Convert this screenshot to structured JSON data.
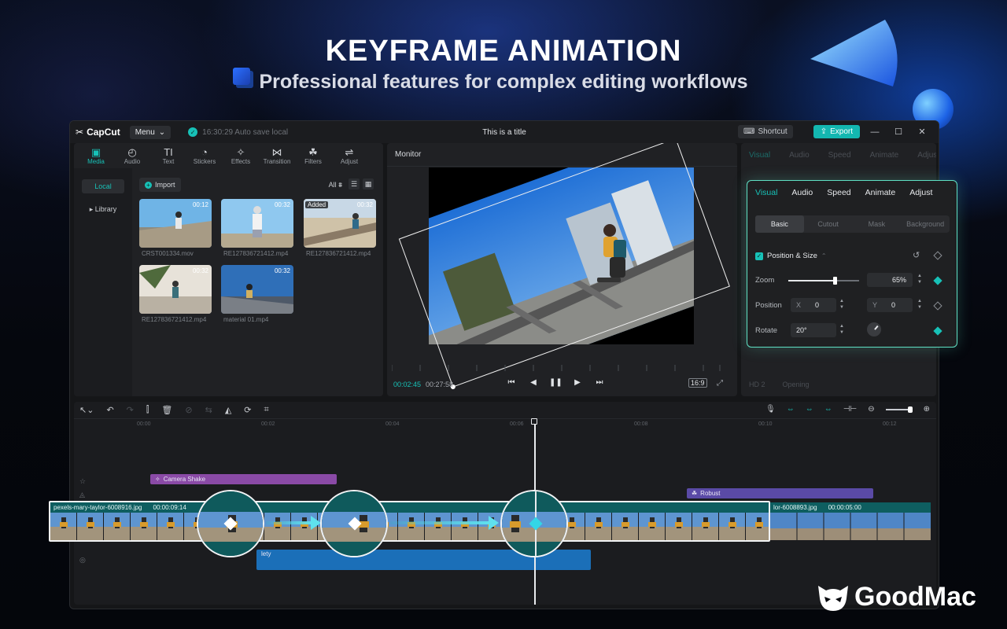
{
  "hero": {
    "title": "KEYFRAME ANIMATION",
    "subtitle": "Professional features for complex editing workflows"
  },
  "titlebar": {
    "app_name": "CapCut",
    "menu_label": "Menu",
    "autosave_text": "16:30:29 Auto save local",
    "document_title": "This is a title",
    "shortcut_label": "Shortcut",
    "export_label": "Export"
  },
  "media_tools": [
    {
      "label": "Media",
      "icon": "media-icon",
      "glyph": "▣",
      "active": true
    },
    {
      "label": "Audio",
      "icon": "audio-icon",
      "glyph": "◴",
      "active": false
    },
    {
      "label": "Text",
      "icon": "text-icon",
      "glyph": "TI",
      "active": false
    },
    {
      "label": "Stickers",
      "icon": "stickers-icon",
      "glyph": "◔",
      "active": false
    },
    {
      "label": "Effects",
      "icon": "effects-icon",
      "glyph": "✧",
      "active": false
    },
    {
      "label": "Transition",
      "icon": "transition-icon",
      "glyph": "⋈",
      "active": false
    },
    {
      "label": "Filters",
      "icon": "filters-icon",
      "glyph": "☘",
      "active": false
    },
    {
      "label": "Adjust",
      "icon": "adjust-icon",
      "glyph": "⇌",
      "active": false
    }
  ],
  "media_side": {
    "local": "Local",
    "library": "▸ Library"
  },
  "media_toolbar": {
    "import_label": "Import",
    "filter_label": "All"
  },
  "media_items": [
    {
      "name": "CRST001334.mov",
      "duration": "00:12",
      "added": ""
    },
    {
      "name": "RE127836721412.mp4",
      "duration": "00:32",
      "added": ""
    },
    {
      "name": "RE127836721412.mp4",
      "duration": "00:32",
      "added": "Added"
    },
    {
      "name": "RE127836721412.mp4",
      "duration": "00:32",
      "added": ""
    },
    {
      "name": "material 01.mp4",
      "duration": "00:32",
      "added": ""
    }
  ],
  "monitor": {
    "label": "Monitor",
    "current_time": "00:02:45",
    "total_time": "00:27:58",
    "ratio": "16:9"
  },
  "props_ghost": {
    "tabs": [
      "Visual",
      "Audio",
      "Speed",
      "Animate",
      "Adjust"
    ],
    "bottom_left": "HD 2",
    "bottom_right": "Opening"
  },
  "props_panel": {
    "tabs": [
      "Visual",
      "Audio",
      "Speed",
      "Animate",
      "Adjust"
    ],
    "subtabs": [
      "Basic",
      "Cutout",
      "Mask",
      "Background"
    ],
    "section_title": "Position & Size",
    "zoom_label": "Zoom",
    "zoom_value": "65%",
    "zoom_level": 0.65,
    "position_label": "Position",
    "x_prefix": "X",
    "x_value": "0",
    "y_prefix": "Y",
    "y_value": "0",
    "rotate_label": "Rotate",
    "rotate_value": "20°"
  },
  "timeline": {
    "ruler_ticks": [
      "00:00",
      "00:02",
      "00:04",
      "00:06",
      "00:08",
      "00:10",
      "00:12"
    ],
    "effect_bar": "Camera Shake",
    "filter_bar": "Robust",
    "main_clip_name": "pexels-mary-taylor-6008916.jpg",
    "main_clip_duration": "00:00:09:14",
    "second_clip_name": "lor-6008893.jpg",
    "second_clip_duration": "00:00:05:00",
    "audio_label": "lety"
  },
  "watermark": {
    "brand": "GoodMac"
  },
  "colors": {
    "accent": "#17c1b7",
    "keyframe_highlight": "#5fe1ee",
    "panel_border": "#5fe1c4",
    "effect_bar": "#8a4aa6",
    "filter_bar": "#5a4aa6",
    "audio_track": "#1b6fb8"
  }
}
